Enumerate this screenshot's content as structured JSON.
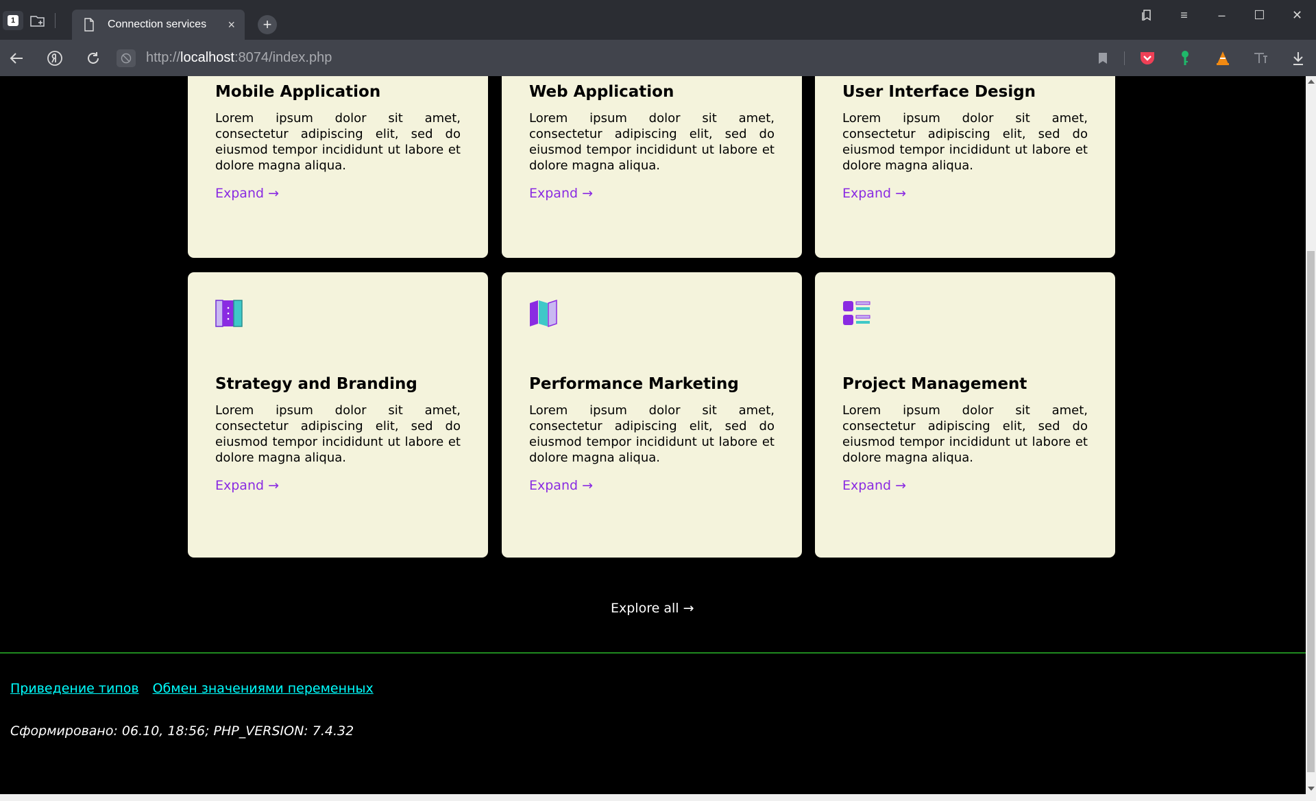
{
  "browser": {
    "tab_counter": "1",
    "tab_title": "Connection services",
    "tab_close": "×",
    "new_tab": "+",
    "url_prefix": "http://",
    "url_host": "localhost",
    "url_path": ":8074/index.php",
    "window_controls": [
      "≡",
      "–",
      "☐",
      "✕"
    ]
  },
  "services": [
    {
      "title": "Mobile Application",
      "text": "Lorem ipsum dolor sit amet, consectetur adipiscing elit, sed do eiusmod tempor incididunt ut labore et dolore magna aliqua.",
      "link": "Expand →"
    },
    {
      "title": "Web Application",
      "text": "Lorem ipsum dolor sit amet, consectetur adipiscing elit, sed do eiusmod tempor incididunt ut labore et dolore magna aliqua.",
      "link": "Expand →"
    },
    {
      "title": "User Interface Design",
      "text": "Lorem ipsum dolor sit amet, consectetur adipiscing elit, sed do eiusmod tempor incididunt ut labore et dolore magna aliqua.",
      "link": "Expand →"
    },
    {
      "title": "Strategy and Branding",
      "text": "Lorem ipsum dolor sit amet, consectetur adipiscing elit, sed do eiusmod tempor incididunt ut labore et dolore magna aliqua.",
      "link": "Expand →",
      "icon": "columns-icon"
    },
    {
      "title": "Performance Marketing",
      "text": "Lorem ipsum dolor sit amet, consectetur adipiscing elit, sed do eiusmod tempor incididunt ut labore et dolore magna aliqua.",
      "link": "Expand →",
      "icon": "map-icon"
    },
    {
      "title": "Project Management",
      "text": "Lorem ipsum dolor sit amet, consectetur adipiscing elit, sed do eiusmod tempor incididunt ut labore et dolore magna aliqua.",
      "link": "Expand →",
      "icon": "list-icon"
    }
  ],
  "explore_all": "Explore all →",
  "footer": {
    "links": [
      "Приведение типов",
      "Обмен значениями переменных"
    ],
    "info": "Сформировано: 06.10, 18:56; PHP_VERSION: 7.4.32"
  },
  "colors": {
    "card_bg": "#f4f3dc",
    "accent_purple": "#8a2be2",
    "link_cyan": "#00ffff",
    "divider_green": "#1f8a1f"
  }
}
